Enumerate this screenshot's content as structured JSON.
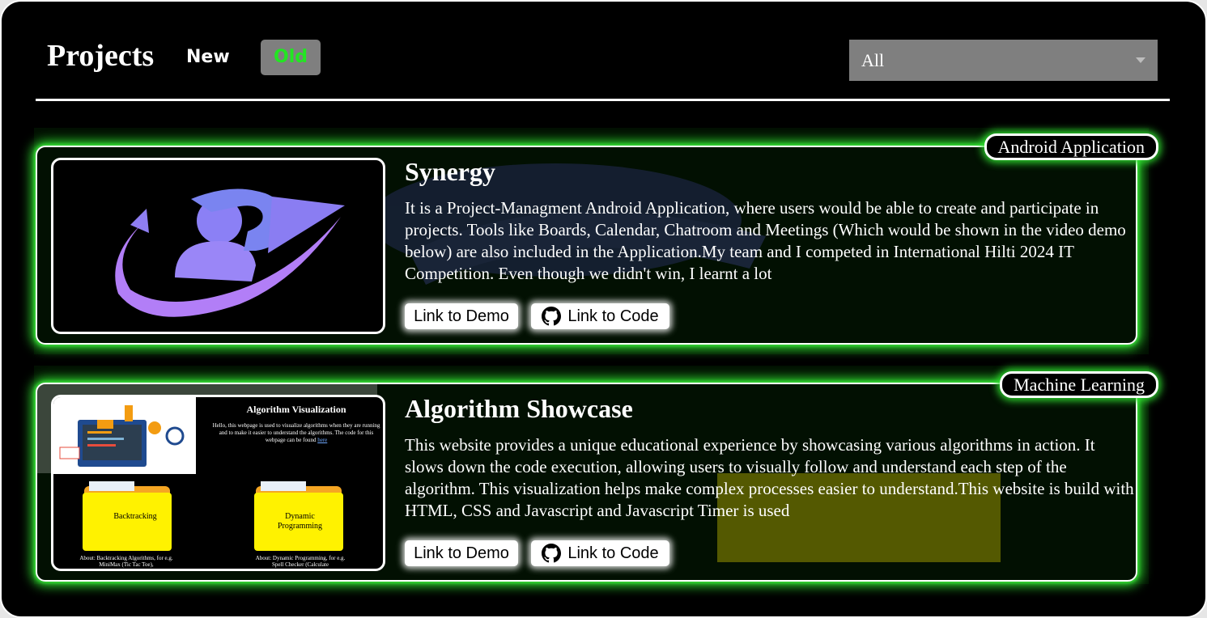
{
  "header": {
    "title": "Projects",
    "tabs": [
      {
        "label": "New",
        "active": false
      },
      {
        "label": "Old",
        "active": true
      }
    ],
    "filter": {
      "selected": "All"
    }
  },
  "projects": [
    {
      "category": "Android Application",
      "title": "Synergy",
      "description": "It is a Project-Managment Android Application, where users would be able to create and participate in projects. Tools like Boards, Calendar, Chatroom and Meetings (Which would be shown in the video demo below) are also included in the Application.My team and I competed in International Hilti 2024 IT Competition. Even though we didn't win, I learnt a lot",
      "demo_label": "Link to Demo",
      "code_label": "Link to Code",
      "image_icon": "synergy-logo",
      "accent": "#a47cf7"
    },
    {
      "category": "Machine Learning",
      "title": "Algorithm Showcase",
      "description": "This website provides a unique educational experience by showcasing various algorithms in action. It slows down the code execution, allowing users to visually follow and understand each step of the algorithm. This visualization helps make complex processes easier to understand.This website is build with HTML, CSS and Javascript and Javascript Timer is used",
      "demo_label": "Link to Demo",
      "code_label": "Link to Code",
      "screenshot": {
        "heading": "Algorithm Visualization",
        "intro": "Hello, this webpage is used to visualize algorithms when they are running and to make it easier to understand the algorithms. The code for this webpage can be found",
        "link": "here",
        "folders": [
          {
            "label": "Backtracking",
            "about": "About: Backtracking Algorithms, for e.g. MiniMax (Tic Tac Toe),"
          },
          {
            "label": "Dynamic Programming",
            "about": "About: Dynamic Programming, for e.g. Spell Checker (Calculate"
          }
        ]
      }
    }
  ],
  "colors": {
    "glow": "#2fe02f",
    "active_tab_text": "#22e622",
    "tab_bg": "#7f7f7f"
  }
}
